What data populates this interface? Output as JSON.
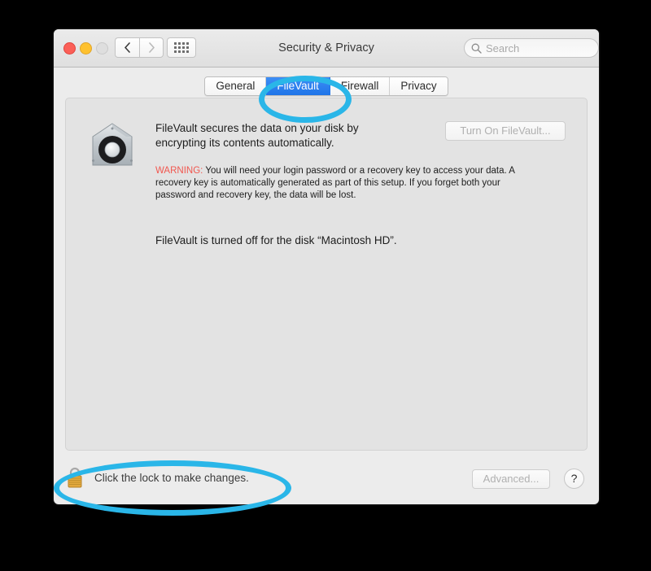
{
  "window": {
    "title": "Security & Privacy",
    "traffic_lights": {
      "close": "close-button",
      "minimize": "minimize-button",
      "zoom": "zoom-button-disabled"
    }
  },
  "toolbar": {
    "back_icon": "chevron-left-icon",
    "forward_icon": "chevron-right-icon",
    "show_all_icon": "grid-dots-icon",
    "search": {
      "icon": "search-icon",
      "value": "",
      "placeholder": "Search"
    }
  },
  "tabs": [
    {
      "label": "General",
      "selected": false
    },
    {
      "label": "FileVault",
      "selected": true
    },
    {
      "label": "Firewall",
      "selected": false
    },
    {
      "label": "Privacy",
      "selected": false
    }
  ],
  "main": {
    "icon": "filevault-safe-icon",
    "description": "FileVault secures the data on your disk by encrypting its contents automatically.",
    "warning_label": "WARNING:",
    "warning_text": " You will need your login password or a recovery key to access your data. A recovery key is automatically generated as part of this setup. If you forget both your password and recovery key, the data will be lost.",
    "status": "FileVault is turned off for the disk “Macintosh HD”.",
    "turn_on_button": "Turn On FileVault...",
    "turn_on_button_enabled": false
  },
  "footer": {
    "lock_icon": "padlock-closed-icon",
    "lock_text": "Click the lock to make changes.",
    "advanced_button": "Advanced...",
    "advanced_button_enabled": false,
    "help_button": "?"
  },
  "annotations": {
    "color": "#2ab6e8",
    "items": [
      {
        "target": "filevault-tab"
      },
      {
        "target": "lock-row"
      }
    ]
  },
  "colors": {
    "accent_tab_blue": "#2b7ef0",
    "warning_red": "#f1574f",
    "annotation_cyan": "#2ab6e8",
    "window_background": "#ececec",
    "panel_background": "#e3e3e3"
  }
}
